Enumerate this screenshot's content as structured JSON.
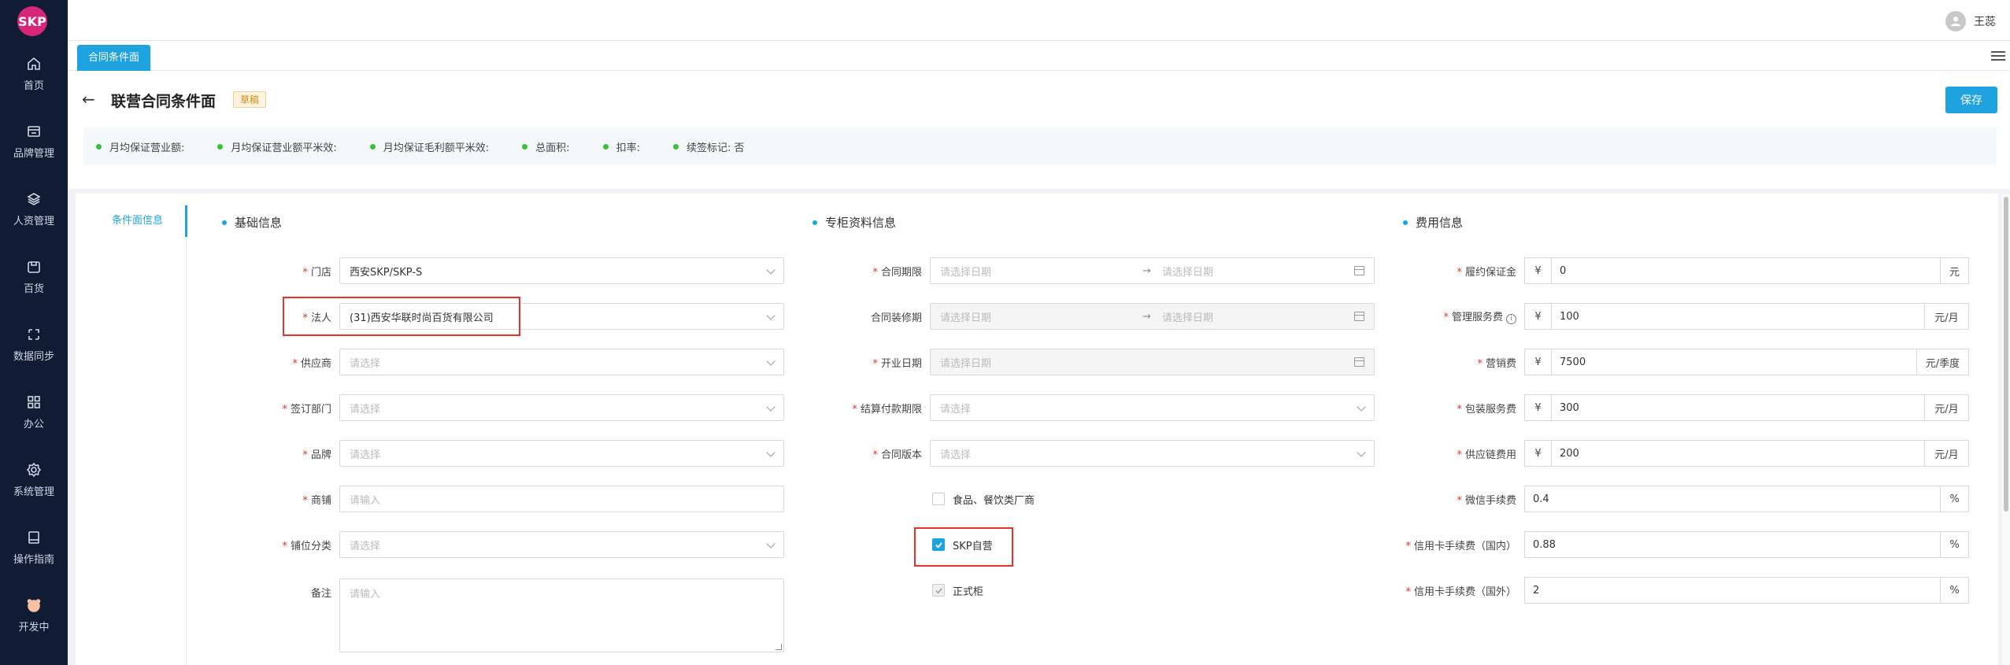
{
  "app": {
    "logo_text": "SKP",
    "user_name": "王蕊"
  },
  "sidebar": {
    "items": [
      {
        "label": "首页",
        "icon": "home-icon"
      },
      {
        "label": "品牌管理",
        "icon": "brand-icon"
      },
      {
        "label": "人资管理",
        "icon": "layers-icon"
      },
      {
        "label": "百货",
        "icon": "store-icon"
      },
      {
        "label": "数据同步",
        "icon": "sync-icon"
      },
      {
        "label": "办公",
        "icon": "grid-icon"
      },
      {
        "label": "系统管理",
        "icon": "gear-icon"
      },
      {
        "label": "操作指南",
        "icon": "book-icon"
      },
      {
        "label": "开发中",
        "icon": "pig-icon"
      }
    ]
  },
  "tabs": {
    "active": "合同条件面"
  },
  "header": {
    "title": "联营合同条件面",
    "status": "草稿",
    "save_label": "保存",
    "summary": [
      "月均保证营业额:",
      "月均保证营业额平米效:",
      "月均保证毛利额平米效:",
      "总面积:",
      "扣率:",
      "续签标记: 否"
    ]
  },
  "side_nav": {
    "active": "条件面信息"
  },
  "basic": {
    "title": "基础信息",
    "store": {
      "label": "门店",
      "value": "西安SKP/SKP-S"
    },
    "legal": {
      "label": "法人",
      "value": "(31)西安华联时尚百货有限公司"
    },
    "supplier": {
      "label": "供应商",
      "placeholder": "请选择"
    },
    "dept": {
      "label": "签订部门",
      "placeholder": "请选择"
    },
    "brand": {
      "label": "品牌",
      "placeholder": "请选择"
    },
    "shop": {
      "label": "商铺",
      "placeholder": "请输入"
    },
    "shop_type": {
      "label": "铺位分类",
      "placeholder": "请选择"
    },
    "remark": {
      "label": "备注",
      "placeholder": "请输入"
    }
  },
  "counter": {
    "title": "专柜资料信息",
    "contract_period": {
      "label": "合同期限",
      "start": "请选择日期",
      "end": "请选择日期"
    },
    "decor_period": {
      "label": "合同装修期",
      "start": "请选择日期",
      "end": "请选择日期"
    },
    "open_date": {
      "label": "开业日期",
      "placeholder": "请选择日期"
    },
    "payment_term": {
      "label": "结算付款期限",
      "placeholder": "请选择"
    },
    "contract_version": {
      "label": "合同版本",
      "placeholder": "请选择"
    },
    "food_vendor": {
      "label": "食品、餐饮类厂商",
      "checked": false
    },
    "skp_self": {
      "label": "SKP自营",
      "checked": true
    },
    "formal_counter": {
      "label": "正式柜",
      "checked": true
    }
  },
  "fees": {
    "title": "费用信息",
    "currency": "¥",
    "deposit": {
      "label": "履约保证金",
      "value": "0",
      "unit": "元"
    },
    "mgmt": {
      "label": "管理服务费",
      "value": "100",
      "unit": "元/月"
    },
    "marketing": {
      "label": "营销费",
      "value": "7500",
      "unit": "元/季度"
    },
    "packaging": {
      "label": "包装服务费",
      "value": "300",
      "unit": "元/月"
    },
    "supply_chain": {
      "label": "供应链费用",
      "value": "200",
      "unit": "元/月"
    },
    "wechat": {
      "label": "微信手续费",
      "value": "0.4",
      "unit": "%"
    },
    "card_domestic": {
      "label": "信用卡手续费（国内）",
      "value": "0.88",
      "unit": "%"
    },
    "card_foreign": {
      "label": "信用卡手续费（国外）",
      "value": "2",
      "unit": "%"
    }
  }
}
